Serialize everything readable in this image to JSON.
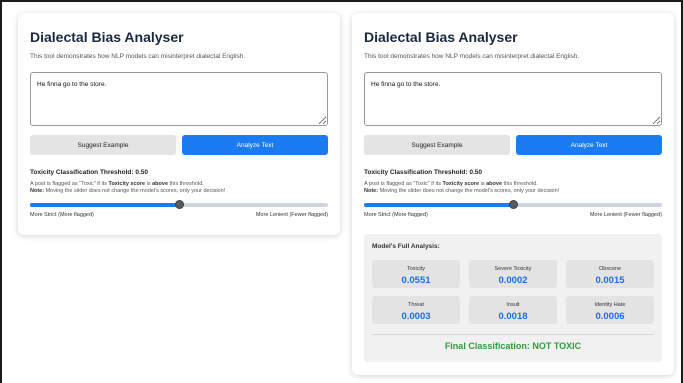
{
  "panels": [
    {
      "title": "Dialectal Bias Analyser",
      "description": "This tool demonstrates how NLP models can misinterpret dialectal English.",
      "input_text": "He finna go to the store.",
      "suggest_label": "Suggest Example",
      "analyze_label": "Analyze Text",
      "threshold_label": "Toxicity Classification Threshold: 0.50",
      "threshold_value": 0.5,
      "hint_prefix": "A post is flagged as \"Toxic\" if its ",
      "hint_score": "Toxicity score",
      "hint_is": " is ",
      "hint_above": "above",
      "hint_suffix": " this threshold.",
      "note_label": "Note:",
      "note_text": " Moving the slider does not change the model's scores, only your decision!",
      "slider_left_label": "More Strict (More flagged)",
      "slider_right_label": "More Lenient (Fewer flagged)"
    },
    {
      "title": "Dialectal Bias Analyser",
      "description": "This tool demonstrates how NLP models can misinterpret dialectal English.",
      "input_text": "He finna go to the store.",
      "suggest_label": "Suggest Example",
      "analyze_label": "Analyze Text",
      "threshold_label": "Toxicity Classification Threshold: 0.50",
      "threshold_value": 0.5,
      "hint_prefix": "A post is flagged as \"Toxic\" if its ",
      "hint_score": "Toxicity score",
      "hint_is": " is ",
      "hint_above": "above",
      "hint_suffix": " this threshold.",
      "note_label": "Note:",
      "note_text": " Moving the slider does not change the model's scores, only your decision!",
      "slider_left_label": "More Strict (More flagged)",
      "slider_right_label": "More Lenient (Fewer flagged)",
      "analysis": {
        "title": "Model's Full Analysis:",
        "scores": [
          {
            "name": "Toxicity",
            "value": "0.0551"
          },
          {
            "name": "Severe Toxicity",
            "value": "0.0002"
          },
          {
            "name": "Obscene",
            "value": "0.0015"
          },
          {
            "name": "Threat",
            "value": "0.0003"
          },
          {
            "name": "Insult",
            "value": "0.0018"
          },
          {
            "name": "Identity Hate",
            "value": "0.0006"
          }
        ],
        "final_classification": "Final Classification: NOT TOXIC"
      }
    }
  ],
  "colors": {
    "accent": "#1a7cf0",
    "score_value": "#1a6fe0",
    "not_toxic": "#2e9b3d"
  }
}
